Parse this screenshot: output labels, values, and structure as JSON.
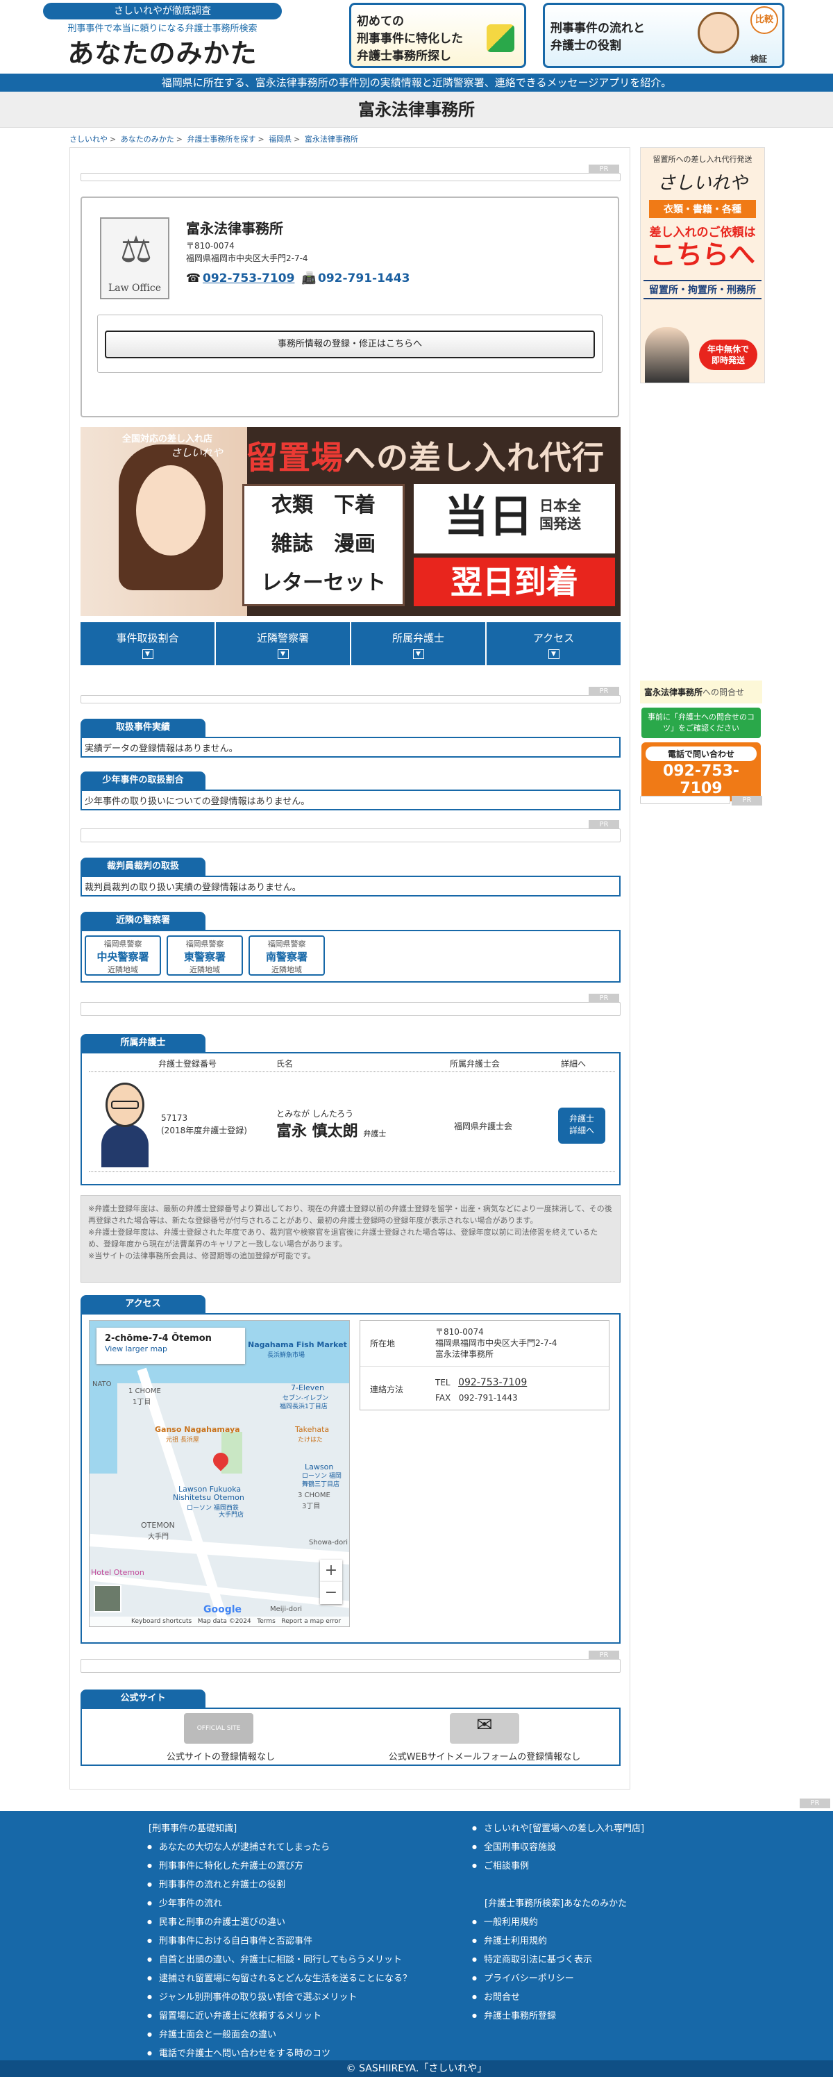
{
  "header": {
    "pill": "さしいれやが徹底調査",
    "subtitle": "刑事事件で本当に頼りになる弁護士事務所検索",
    "logo": "あなたのみかた",
    "banner1_lines": [
      "初めての",
      "刑事事件に特化した",
      "弁護士事務所探し"
    ],
    "banner2_lines": [
      "刑事事件の流れと",
      "弁護士の役割"
    ],
    "banner2_badge": "比較",
    "banner2_badge2": "検証"
  },
  "bluebar": "福岡県に所在する、富永法律事務所の事件別の実績情報と近隣警察署、連絡できるメッセージアプリを紹介。",
  "page_title": "富永法律事務所",
  "breadcrumb": [
    "さしいれや",
    "あなたのみかた",
    "弁護士事務所を探す",
    "福岡県",
    "富永法律事務所"
  ],
  "pr": "PR",
  "office": {
    "logo_text": "Law Office",
    "name": "富永法律事務所",
    "zip": "〒810-0074",
    "address": "福岡県福岡市中央区大手門2-7-4",
    "tel": "092-753-7109",
    "fax": "092-791-1443",
    "register_button": "事務所情報の登録・修正はこちらへ"
  },
  "ad_main": {
    "top_small": "全国対応の差し入れ店",
    "top_logo": "さしいれや",
    "headline_pre": "留置場",
    "headline_post": "への差し入れ代行",
    "goods": [
      "衣類　下着",
      "雑誌　漫画",
      "レターセット"
    ],
    "ship_big": "当日",
    "ship_small": "日本全国発送",
    "next_day": "翌日到着"
  },
  "tabs": [
    {
      "label": "事件取扱割合"
    },
    {
      "label": "近隣警察署"
    },
    {
      "label": "所属弁護士"
    },
    {
      "label": "アクセス"
    }
  ],
  "sections": {
    "cases": {
      "title": "取扱事件実績",
      "body": "実績データの登録情報はありません。"
    },
    "juvenile": {
      "title": "少年事件の取扱割合",
      "body": "少年事件の取り扱いについての登録情報はありません。"
    },
    "saiban": {
      "title": "裁判員裁判の取扱",
      "body": "裁判員裁判の取り扱い実績の登録情報はありません。"
    },
    "police": {
      "title": "近隣の警察署",
      "items": [
        {
          "pref": "福岡県警察",
          "name": "中央警察署",
          "note": "近隣地域"
        },
        {
          "pref": "福岡県警察",
          "name": "東警察署",
          "note": "近隣地域"
        },
        {
          "pref": "福岡県警察",
          "name": "南警察署",
          "note": "近隣地域"
        }
      ]
    },
    "lawyers": {
      "title": "所属弁護士",
      "headers": [
        "弁護士登録番号",
        "氏名",
        "所属弁護士会",
        "詳細へ"
      ],
      "rows": [
        {
          "reg_no": "57173",
          "reg_year": "(2018年度弁護士登録)",
          "kana": "とみなが しんたろう",
          "name": "富永 慎太朗",
          "suffix": "弁護士",
          "bar": "福岡県弁護士会",
          "button_line1": "弁護士",
          "button_line2": "詳細へ"
        }
      ]
    },
    "notes": [
      "※弁護士登録年度は、最新の弁護士登録番号より算出しており、現在の弁護士登録以前の弁護士登録を留学・出産・病気などにより一度抹消して、その後再登録された場合等は、新たな登録番号が付与されることがあり、最初の弁護士登録時の登録年度が表示されない場合があります。",
      "※弁護士登録年度は、弁護士登録された年度であり、裁判官や検察官を退官後に弁護士登録された場合等は、登録年度以前に司法修習を終えているため、登録年度から現在が法曹業界のキャリアと一致しない場合があります。",
      "※当サイトの法律事務所会員は、修習期等の追加登録が可能です。"
    ],
    "access": {
      "title": "アクセス",
      "map_place": "2-chōme-7-4 Ōtemon",
      "map_link": "View larger map",
      "map_labels": [
        "Nagahama Fish Market",
        "長浜鮮魚市場",
        "NATO",
        "1 CHOME",
        "1丁目",
        "7-Eleven",
        "セブン-イレブン",
        "福岡長浜1丁目店",
        "Ganso Nagahamaya",
        "元祖 長浜屋",
        "Takehata",
        "たけはた",
        "Lawson Fukuoka",
        "Nishitetsu Otemon",
        "ローソン 福岡西鉄",
        "大手門店",
        "3 CHOME",
        "3丁目",
        "OTEMON",
        "大手門",
        "Showa-dori",
        "Hotel Otemon",
        "Meiji-dori",
        "Lawson",
        "ローソン 福岡",
        "舞鶴三丁目店",
        "Google"
      ],
      "map_footer": [
        "Keyboard shortcuts",
        "Map data ©2024",
        "Terms",
        "Report a map error"
      ],
      "addr_label": "所在地",
      "addr_lines": [
        "〒810-0074",
        "福岡県福岡市中央区大手門2-7-4",
        "富永法律事務所"
      ],
      "contact_label": "連絡方法",
      "tel_label": "TEL",
      "tel": "092-753-7109",
      "fax_label": "FAX",
      "fax": "092-791-1443"
    },
    "site": {
      "title": "公式サイト",
      "site_icon_text": "OFFICIAL SITE",
      "site_none": "公式サイトの登録情報なし",
      "mail_icon_text": "MAIL",
      "mail_none": "公式WEBサイトメールフォームの登録情報なし"
    }
  },
  "side_ad": {
    "top": "留置所への差し入れ代行発送",
    "logo": "さしいれや",
    "items": "衣類・書籍・各種",
    "catch": "差し入れのご依頼は",
    "cta": "こちらへ",
    "places": "留置所・拘置所・刑務所",
    "badge": "年中無休で即時発送"
  },
  "side_contact": {
    "office": "富永法律事務所",
    "suffix": "への問合せ",
    "green": "事前に「弁護士への問合せのコツ」をご確認ください",
    "call_label": "電話で問い合わせ",
    "tel": "092-753-7109"
  },
  "footer": {
    "left_heading": "[刑事事件の基礎知識]",
    "left_items": [
      "あなたの大切な人が逮捕されてしまったら",
      "刑事事件に特化した弁護士の選び方",
      "刑事事件の流れと弁護士の役割",
      "少年事件の流れ",
      "民事と刑事の弁護士選びの違い",
      "刑事事件における自白事件と否認事件",
      "自首と出頭の違い、弁護士に相談・同行してもらうメリット",
      "逮捕され留置場に勾留されるとどんな生活を送ることになる？",
      "ジャンル別刑事件の取り扱い割合で選ぶメリット",
      "留置場に近い弁護士に依頼するメリット",
      "弁護士面会と一般面会の違い",
      "電話で弁護士へ問い合わせをする時のコツ"
    ],
    "right_items1": [
      "さしいれや[留置場への差し入れ専門店]",
      "全国刑事収容施設",
      "ご相談事例"
    ],
    "right_heading": "[弁護士事務所検索]あなたのみかた",
    "right_items2": [
      "一般利用規約",
      "弁護士利用規約",
      "特定商取引法に基づく表示",
      "プライバシーポリシー",
      "お問合せ",
      "弁護士事務所登録"
    ],
    "copyright": "© SASHIIREYA.「さしいれや」"
  },
  "colors": {
    "brand": "#1768a8",
    "accent_orange": "#f07a16",
    "green": "#2aa84a"
  }
}
